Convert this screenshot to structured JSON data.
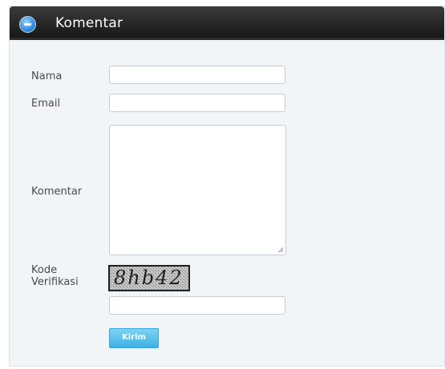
{
  "panel": {
    "title": "Komentar",
    "toggle_icon": "minus-circle-icon"
  },
  "form": {
    "nama_label": "Nama",
    "nama_value": "",
    "email_label": "Email",
    "email_value": "",
    "komentar_label": "Komentar",
    "komentar_value": "",
    "kode_label_line1": "Kode",
    "kode_label_line2": "Verifikasi",
    "captcha_text": "8hb42",
    "kode_value": "",
    "submit_label": "Kirim"
  },
  "colors": {
    "header": "#1f1f1f",
    "panel_bg": "#f1f5f8",
    "button": "#52bde9"
  }
}
